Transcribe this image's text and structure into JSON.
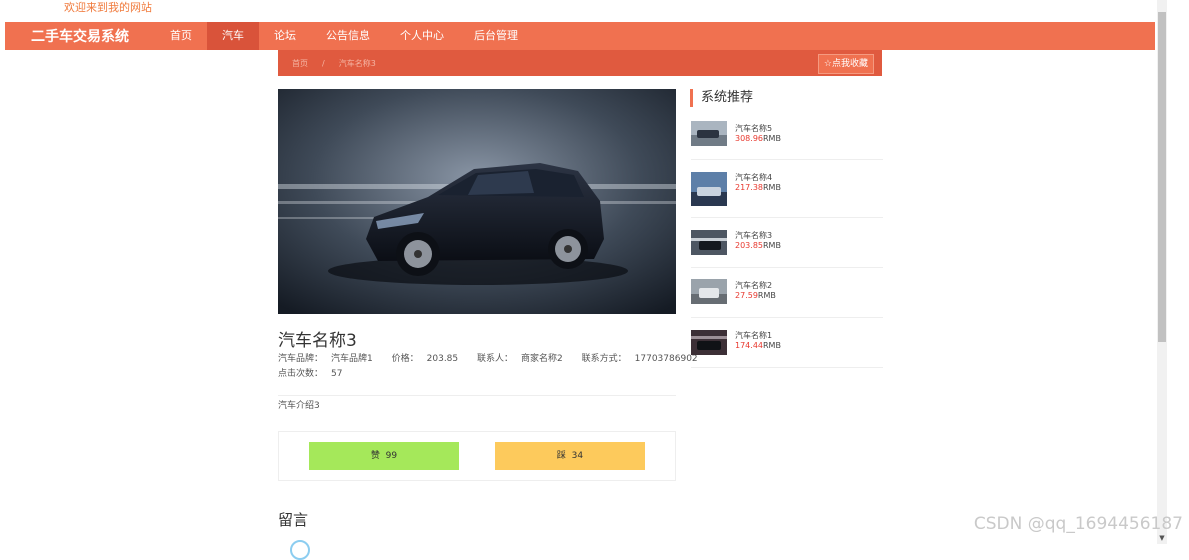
{
  "header": {
    "welcome": "欢迎来到我的网站"
  },
  "nav": {
    "brand": "二手车交易系统",
    "items": [
      {
        "label": "首页"
      },
      {
        "label": "汽车"
      },
      {
        "label": "论坛"
      },
      {
        "label": "公告信息"
      },
      {
        "label": "个人中心"
      },
      {
        "label": "后台管理"
      }
    ],
    "active_index": 1
  },
  "breadcrumb": {
    "home": "首页",
    "separator": "/",
    "current": "汽车名称3",
    "favorite_label": "☆点我收藏"
  },
  "detail": {
    "title": "汽车名称3",
    "brand_label": "汽车品牌：",
    "brand_value": "汽车品牌1",
    "price_label": "价格：",
    "price_value": "203.85",
    "contact_label": "联系人：",
    "contact_value": "商家名称2",
    "phone_label": "联系方式：",
    "phone_value": "17703786902",
    "clicks_label": "点击次数：",
    "clicks_value": "57",
    "intro": "汽车介绍3",
    "like_label": "赞",
    "like_count": "99",
    "dislike_label": "踩",
    "dislike_count": "34"
  },
  "comments": {
    "heading": "留言"
  },
  "recommend": {
    "title": "系统推荐",
    "currency": "RMB",
    "items": [
      {
        "name": "汽车名称5",
        "price": "308.96"
      },
      {
        "name": "汽车名称4",
        "price": "217.38"
      },
      {
        "name": "汽车名称3",
        "price": "203.85"
      },
      {
        "name": "汽车名称2",
        "price": "27.59"
      },
      {
        "name": "汽车名称1",
        "price": "174.44"
      }
    ]
  },
  "watermark": "CSDN @qq_1694456187",
  "colors": {
    "primary": "#f07150",
    "primary_dark": "#e05a3f",
    "like": "#a5e85a",
    "dislike": "#fdca5c",
    "price": "#e8392f"
  }
}
